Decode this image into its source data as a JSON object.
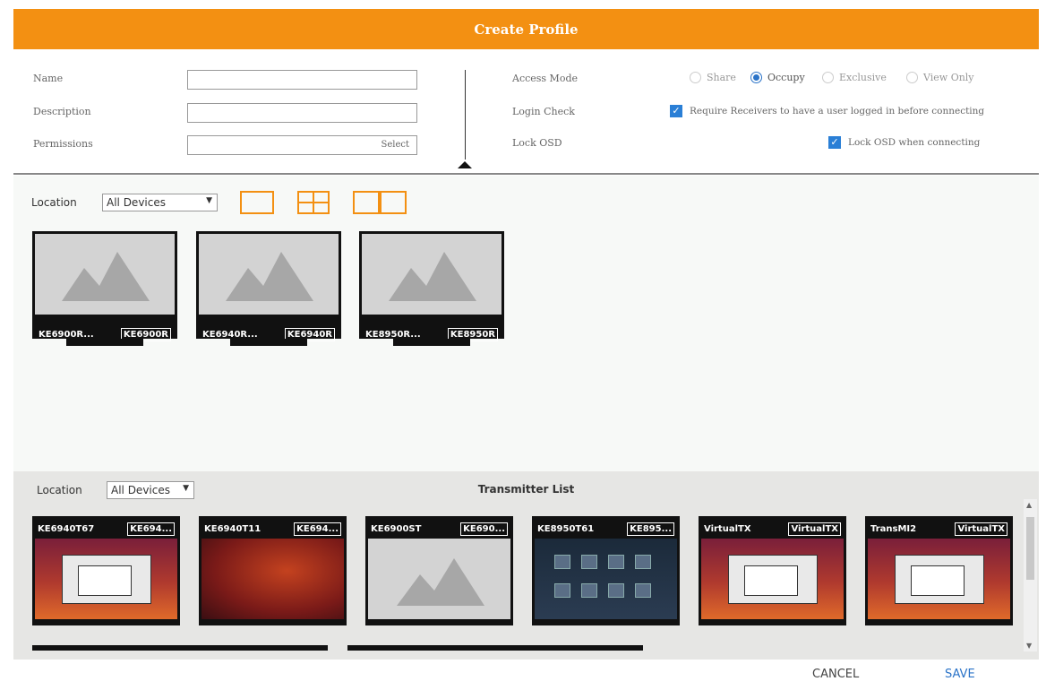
{
  "dialog": {
    "title": "Create Profile"
  },
  "form": {
    "name_label": "Name",
    "name_value": "",
    "description_label": "Description",
    "description_value": "",
    "permissions_label": "Permissions",
    "permissions_button": "Select"
  },
  "access": {
    "access_mode_label": "Access Mode",
    "modes": [
      "Share",
      "Occupy",
      "Exclusive",
      "View Only"
    ],
    "selected_mode": "Occupy",
    "login_check_label": "Login Check",
    "login_check_text": "Require Receivers to have a user logged in before connecting",
    "login_check_checked": true,
    "lock_osd_label": "Lock OSD",
    "lock_osd_text": "Lock OSD when connecting",
    "lock_osd_checked": true
  },
  "receivers": {
    "location_label": "Location",
    "location_value": "All Devices",
    "layout_icons": [
      "single-screen-icon",
      "quad-screen-icon",
      "dual-screen-icon"
    ],
    "monitors": [
      {
        "name": "KE6900R...",
        "tag": "KE6900R"
      },
      {
        "name": "KE6940R...",
        "tag": "KE6940R"
      },
      {
        "name": "KE8950R...",
        "tag": "KE8950R"
      }
    ]
  },
  "transmitters": {
    "location_label": "Location",
    "location_value": "All Devices",
    "list_title": "Transmitter List",
    "items": [
      {
        "name": "KE6940T67",
        "tag": "KE694...",
        "preview": "desktop"
      },
      {
        "name": "KE6940T11",
        "tag": "KE694...",
        "preview": "desktop-red"
      },
      {
        "name": "KE6900ST",
        "tag": "KE690...",
        "preview": "blank"
      },
      {
        "name": "KE8950T61",
        "tag": "KE895...",
        "preview": "tiles"
      },
      {
        "name": "VirtualTX",
        "tag": "VirtualTX",
        "preview": "desktop"
      },
      {
        "name": "TransMI2",
        "tag": "VirtualTX",
        "preview": "desktop"
      }
    ]
  },
  "footer": {
    "cancel_label": "CANCEL",
    "save_label": "SAVE"
  },
  "colors": {
    "accent": "#f39012",
    "checkbox": "#2a7fd6",
    "save": "#2a73c8"
  }
}
